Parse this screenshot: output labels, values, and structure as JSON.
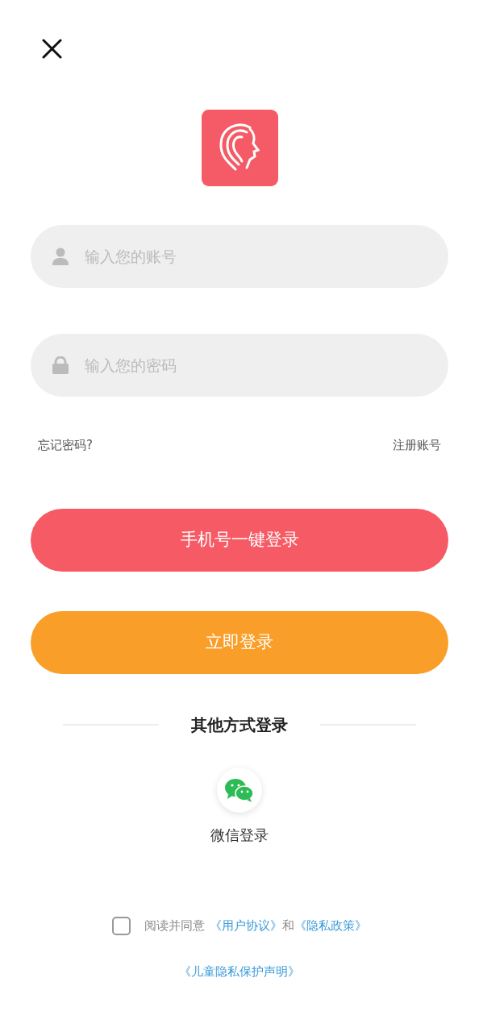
{
  "fields": [
    {
      "kind": "account",
      "placeholder": "输入您的账号"
    },
    {
      "kind": "password",
      "placeholder": "输入您的密码"
    }
  ],
  "forgot_link": "忘记密码?",
  "register_link": "注册账号",
  "buttons": [
    {
      "kind": "phone",
      "label": "手机号一键登录"
    },
    {
      "kind": "login",
      "label": "立即登录"
    }
  ],
  "other_login": {
    "heading": "其他方式登录",
    "options": [
      {
        "kind": "wechat",
        "label": "微信登录"
      }
    ]
  },
  "agreement": {
    "checked": false,
    "parts": [
      {
        "kind": "text",
        "text": "阅读并同意"
      },
      {
        "kind": "link",
        "text": "《用户协议》"
      },
      {
        "kind": "text",
        "text": "和"
      },
      {
        "kind": "link",
        "text": "《隐私政策》"
      }
    ]
  },
  "child_privacy_link": "《儿童隐私保护声明》"
}
